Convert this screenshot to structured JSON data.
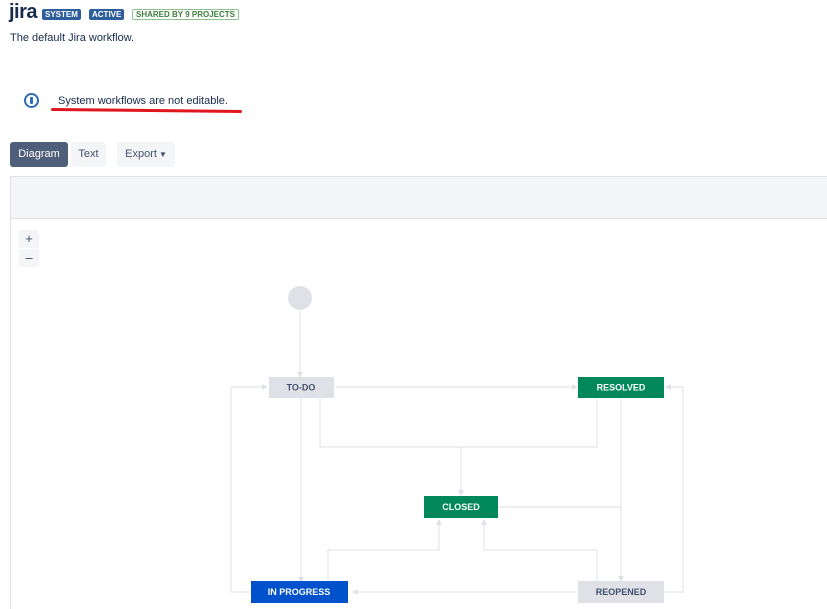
{
  "header": {
    "title": "jira",
    "lozenges": {
      "system": "SYSTEM",
      "active": "ACTIVE",
      "shared": "SHARED BY 9 PROJECTS"
    },
    "subtitle": "The default Jira workflow."
  },
  "notice": {
    "text": "System workflows are not editable."
  },
  "toolbar": {
    "diagram": "Diagram",
    "text": "Text",
    "export": "Export"
  },
  "zoom": {
    "in": "+",
    "out": "–"
  },
  "workflow": {
    "statuses": {
      "todo": {
        "label": "TO-DO",
        "category": "todo"
      },
      "resolved": {
        "label": "RESOLVED",
        "category": "done"
      },
      "closed": {
        "label": "CLOSED",
        "category": "done"
      },
      "in_progress": {
        "label": "IN PROGRESS",
        "category": "in-progress"
      },
      "reopened": {
        "label": "REOPENED",
        "category": "todo"
      }
    },
    "colors": {
      "todo_bg": "#dfe1e6",
      "todo_text": "#42526e",
      "done_bg": "#00875a",
      "done_text": "#ffffff",
      "progress_bg": "#0052cc",
      "progress_text": "#ffffff",
      "line": "#dfe1e6",
      "start": "#dfe1e6"
    }
  }
}
